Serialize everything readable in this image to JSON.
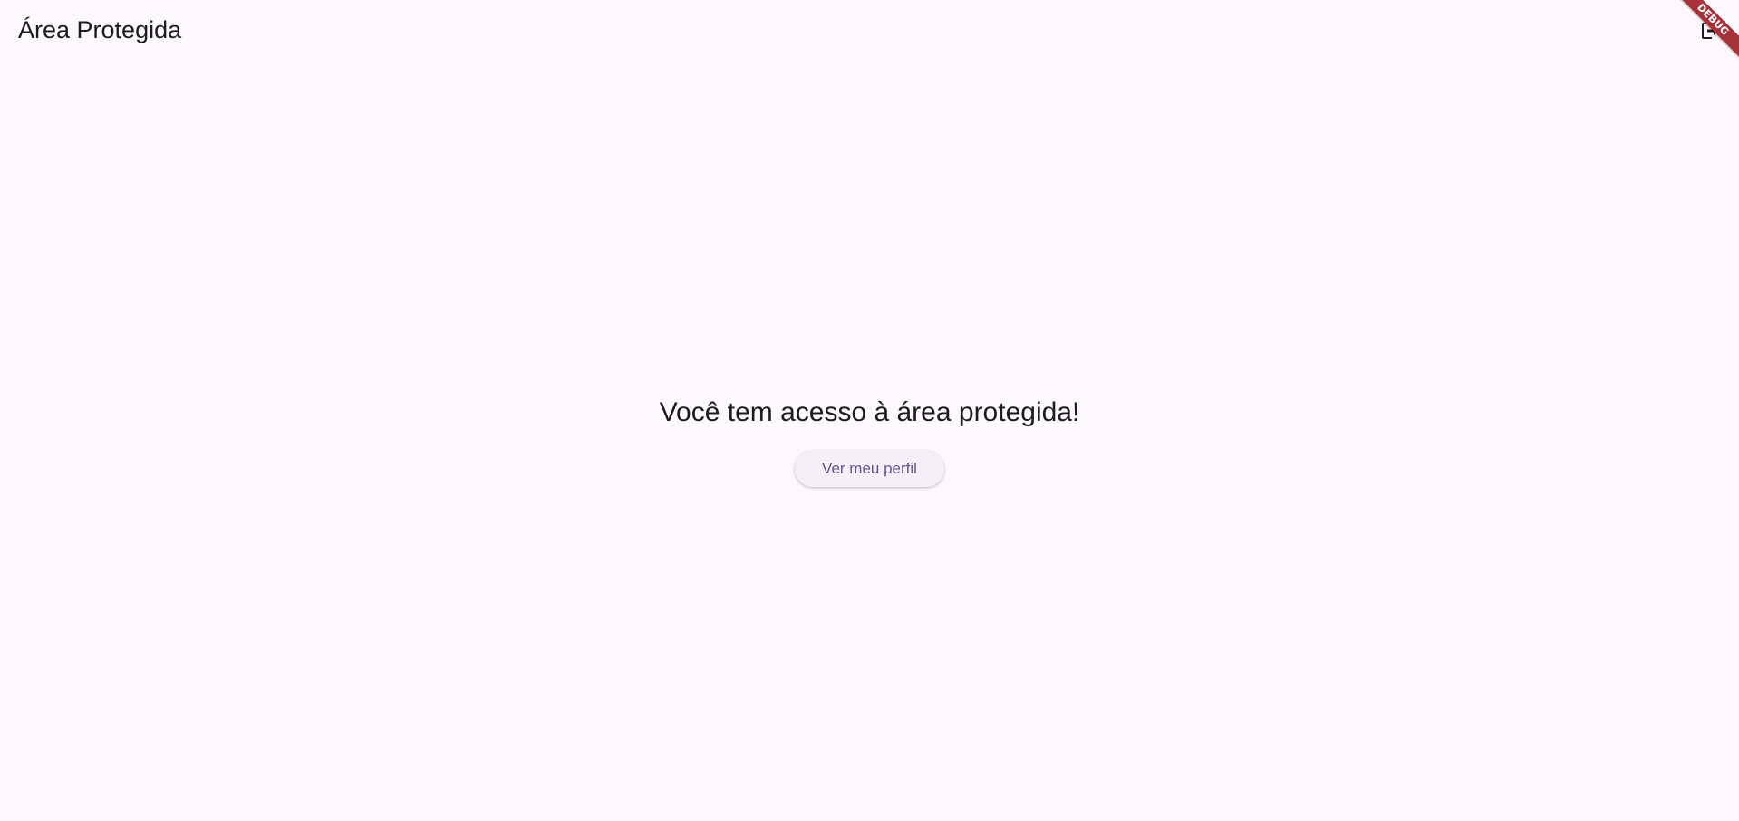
{
  "app_bar": {
    "title": "Área Protegida",
    "action_icon": "logout-icon"
  },
  "debug_banner": {
    "label": "DEBUG",
    "color": "#a8323a"
  },
  "main": {
    "message": "Você tem acesso à área protegida!",
    "profile_button_label": "Ver meu perfil"
  },
  "colors": {
    "background": "#fdf7fe",
    "text": "#1d1b20",
    "button_text": "#65558f",
    "button_bg": "#f6eff8"
  }
}
